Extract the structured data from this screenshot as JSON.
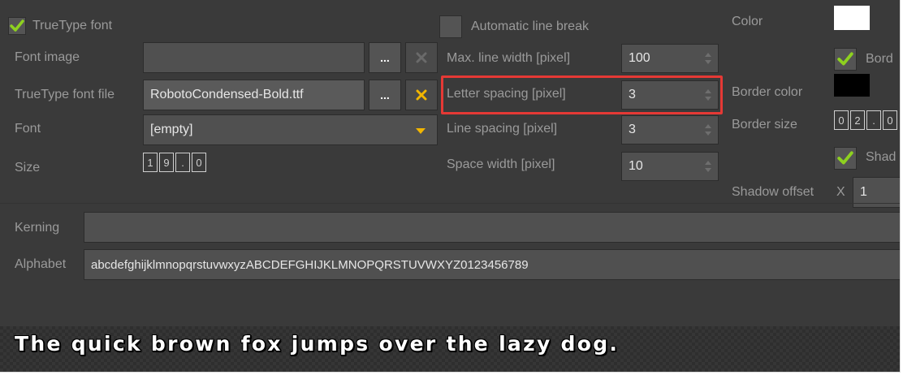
{
  "truetype_font": {
    "label": "TrueType font",
    "checked": true
  },
  "font_image": {
    "label": "Font image",
    "value": ""
  },
  "truetype_file": {
    "label": "TrueType font file",
    "value": "RobotoCondensed-Bold.ttf"
  },
  "font": {
    "label": "Font",
    "value": "[empty]"
  },
  "size": {
    "label": "Size",
    "digits": [
      "1",
      "9",
      ".",
      "0"
    ]
  },
  "browse_label": "...",
  "clear_label": "✕",
  "auto_line_break": {
    "label": "Automatic line break",
    "checked": false
  },
  "max_line_width": {
    "label": "Max. line width [pixel]",
    "value": "100"
  },
  "letter_spacing": {
    "label": "Letter spacing [pixel]",
    "value": "3"
  },
  "line_spacing": {
    "label": "Line spacing [pixel]",
    "value": "3"
  },
  "space_width": {
    "label": "Space width [pixel]",
    "value": "10"
  },
  "color": {
    "label": "Color",
    "value": "#ffffff"
  },
  "border": {
    "label": "Bord",
    "checked": true
  },
  "border_color": {
    "label": "Border color",
    "value": "#000000"
  },
  "border_size": {
    "label": "Border size",
    "digits": [
      "0",
      "2",
      ".",
      "0"
    ]
  },
  "shadow": {
    "label": "Shad",
    "checked": true
  },
  "shadow_offset": {
    "label": "Shadow offset",
    "x_label": "X",
    "x_value": "1"
  },
  "kerning": {
    "label": "Kerning",
    "value": ""
  },
  "alphabet": {
    "label": "Alphabet",
    "value": "abcdefghijklmnopqrstuvwxyzABCDEFGHIJKLMNOPQRSTUVWXYZ0123456789"
  },
  "preview": {
    "text": "The quick brown fox jumps over the lazy dog."
  },
  "colors": {
    "check": "#8ed11f",
    "clear_active": "#f2b600",
    "clear_inactive": "#6a6a6a",
    "highlight": "#e53935"
  }
}
